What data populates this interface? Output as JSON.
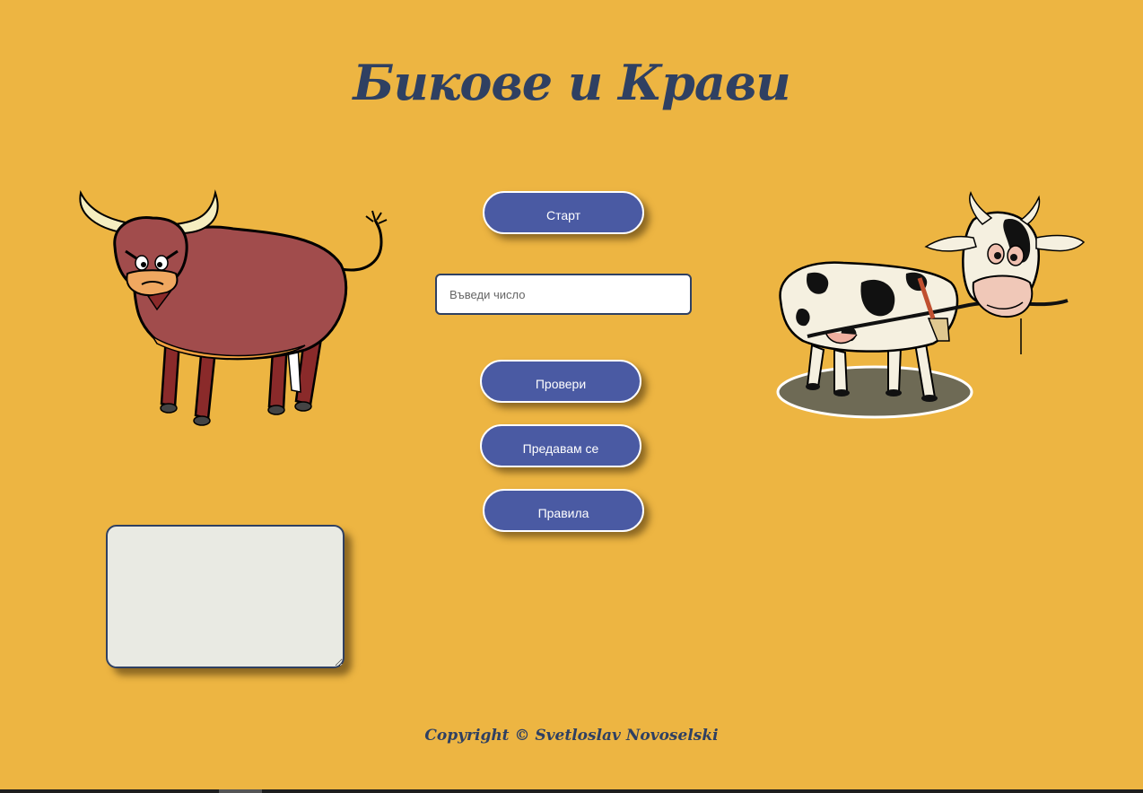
{
  "title": "Бикове и Крави",
  "buttons": {
    "start": "Старт",
    "check": "Провери",
    "give_up": "Предавам се",
    "rules": "Правила"
  },
  "number_input": {
    "placeholder": "Въведи число",
    "value": ""
  },
  "log_area": {
    "value": ""
  },
  "footer": "Copyright © Svetloslav Novoselski",
  "colors": {
    "background": "#edb542",
    "button": "#4a5aa3",
    "title": "#2f4062",
    "textarea": "#e9eae3"
  },
  "images": {
    "left": "bull-illustration",
    "right": "cow-illustration"
  }
}
